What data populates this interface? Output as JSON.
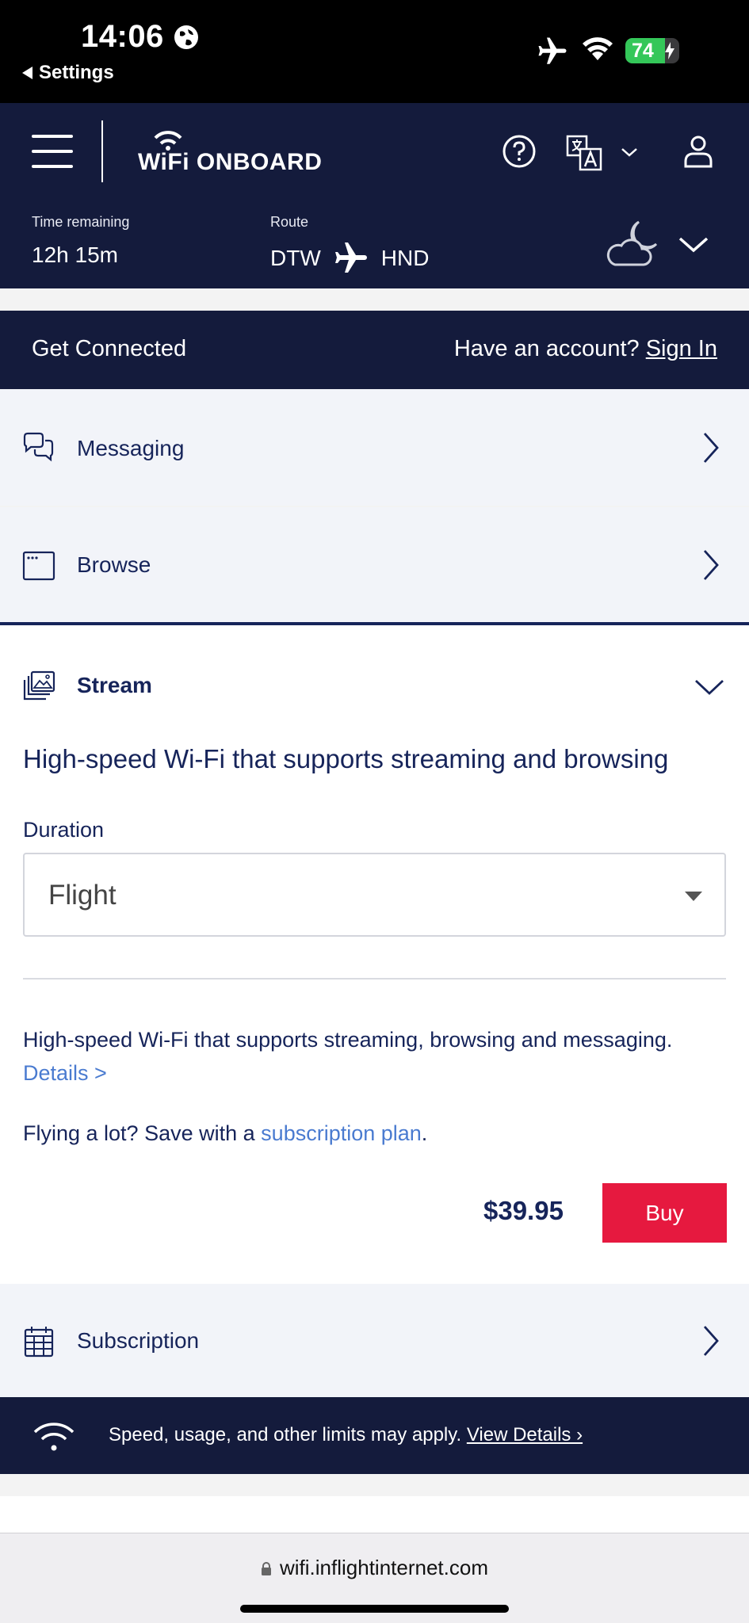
{
  "status_bar": {
    "time": "14:06",
    "back_label": "Settings",
    "battery": "74",
    "battery_level": 0.74,
    "battery_color": "#34c759"
  },
  "header": {
    "brand": "WiFi ONBOARD",
    "time_remaining_label": "Time remaining",
    "time_remaining_value": "12h 15m",
    "route_label": "Route",
    "route_from": "DTW",
    "route_to": "HND",
    "icons": [
      "menu-icon",
      "help-icon",
      "translate-icon",
      "chevron-down-icon",
      "user-icon",
      "weather-icon"
    ]
  },
  "connect_bar": {
    "title": "Get Connected",
    "account_prompt": "Have an account?",
    "sign_in": "Sign In"
  },
  "sections": {
    "messaging": "Messaging",
    "browse": "Browse",
    "subscription": "Subscription"
  },
  "stream": {
    "title": "Stream",
    "headline": "High-speed Wi-Fi that supports streaming and browsing",
    "duration_label": "Duration",
    "duration_value": "Flight",
    "description": "High-speed Wi-Fi that supports streaming, browsing and messaging.",
    "details_link": "Details >",
    "promo_prefix": "Flying a lot? Save with a",
    "promo_link": "subscription plan",
    "promo_suffix": ".",
    "price": "$39.95",
    "buy_label": "Buy"
  },
  "notice": {
    "text": "Speed, usage, and other limits may apply.",
    "link": "View Details ›"
  },
  "url_bar": {
    "url": "wifi.inflightinternet.com"
  },
  "colors": {
    "navy": "#141b3c",
    "text_navy": "#16245a",
    "buy_red": "#e6193f",
    "link_blue": "#4a7bd0",
    "row_bg": "#f2f4f9"
  }
}
